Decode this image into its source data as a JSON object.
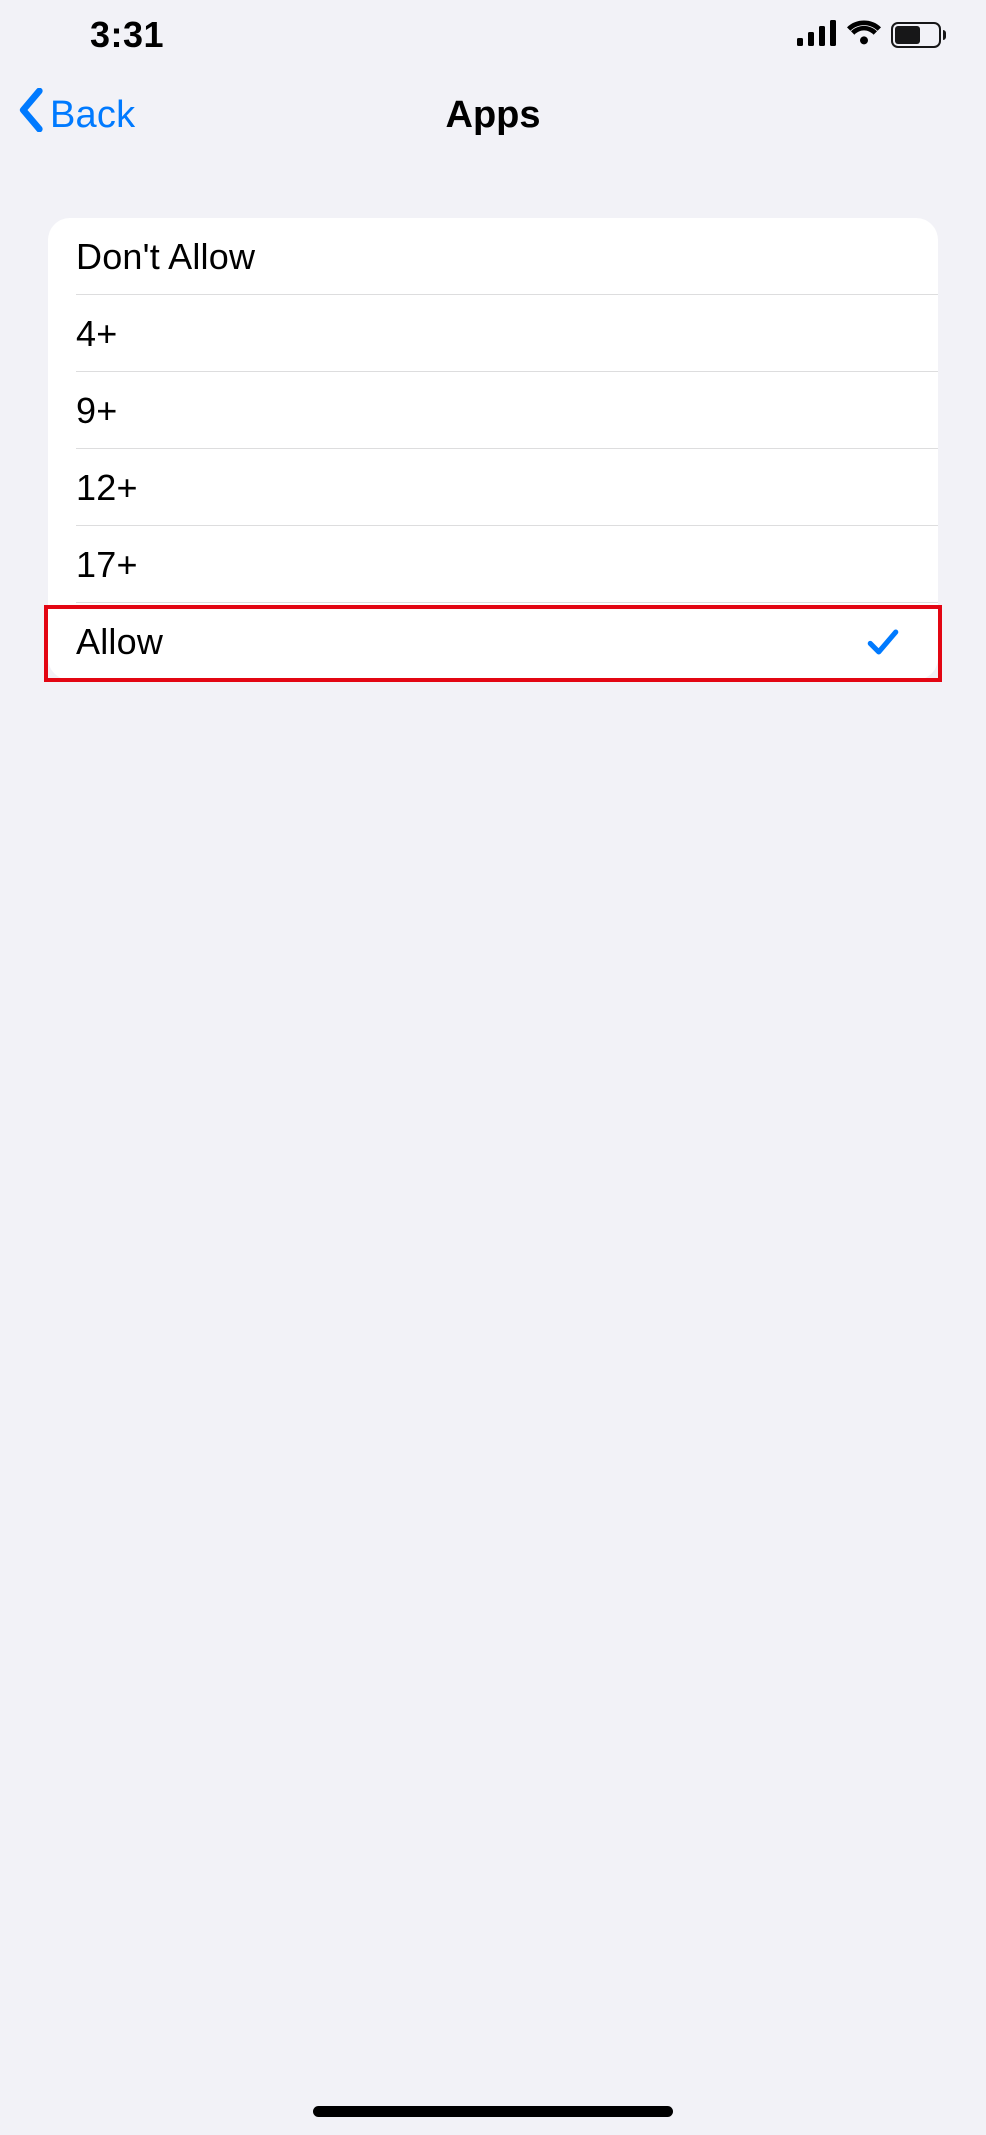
{
  "status": {
    "time": "3:31"
  },
  "nav": {
    "back_label": "Back",
    "title": "Apps"
  },
  "options": [
    {
      "label": "Don't Allow",
      "selected": false
    },
    {
      "label": "4+",
      "selected": false
    },
    {
      "label": "9+",
      "selected": false
    },
    {
      "label": "12+",
      "selected": false
    },
    {
      "label": "17+",
      "selected": false
    },
    {
      "label": "Allow",
      "selected": true,
      "highlighted": true
    }
  ]
}
